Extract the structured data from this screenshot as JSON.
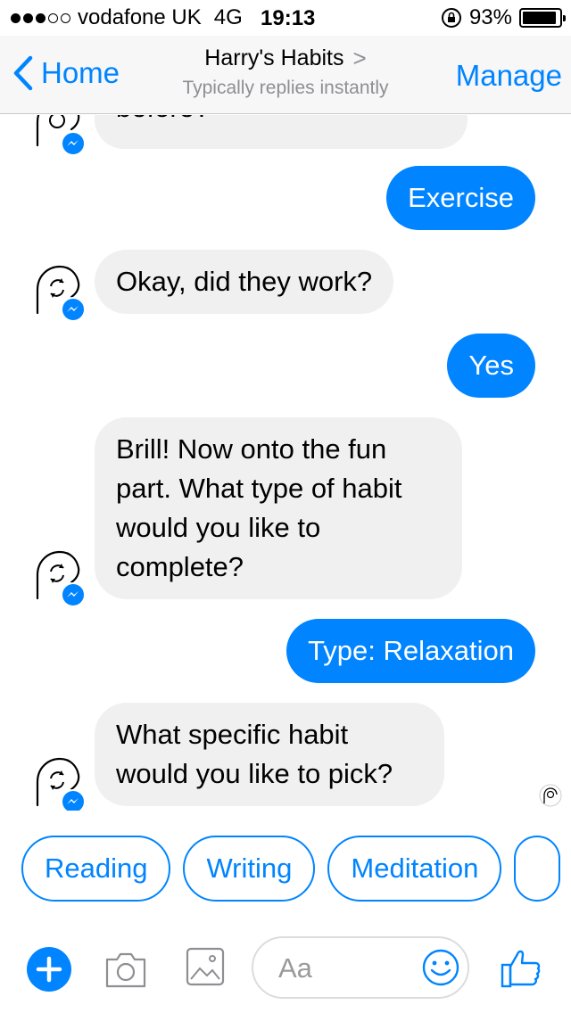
{
  "status_bar": {
    "carrier": "vodafone UK",
    "network": "4G",
    "time": "19:13",
    "battery": "93%",
    "battery_level": 0.93,
    "signal_bars": 3,
    "signal_total": 5
  },
  "nav": {
    "back_label": "Home",
    "title": "Harry's Habits",
    "title_chevron": ">",
    "subtitle": "Typically replies instantly",
    "manage_label": "Manage"
  },
  "messages": [
    {
      "from": "bot",
      "text": "before?"
    },
    {
      "from": "user",
      "text": "Exercise"
    },
    {
      "from": "bot",
      "text": "Okay, did they work?"
    },
    {
      "from": "user",
      "text": "Yes"
    },
    {
      "from": "bot",
      "lines": [
        "Brill! Now onto the fun",
        "part. What type of habit",
        "would you like to",
        "complete?"
      ]
    },
    {
      "from": "user",
      "text": "Type: Relaxation"
    },
    {
      "from": "bot",
      "lines": [
        "What specific habit",
        "would you like to pick?"
      ]
    }
  ],
  "quick_replies": [
    "Reading",
    "Writing",
    "Meditation",
    ""
  ],
  "composer": {
    "placeholder": "Aa",
    "icons": [
      "plus-icon",
      "camera-icon",
      "image-icon",
      "emoji-icon",
      "thumbs-up-icon"
    ]
  },
  "colors": {
    "accent": "#0084ff",
    "bot_bubble": "#f1f0f0",
    "nav_background": "#f7f7f7",
    "secondary_text": "#8e8e93"
  }
}
